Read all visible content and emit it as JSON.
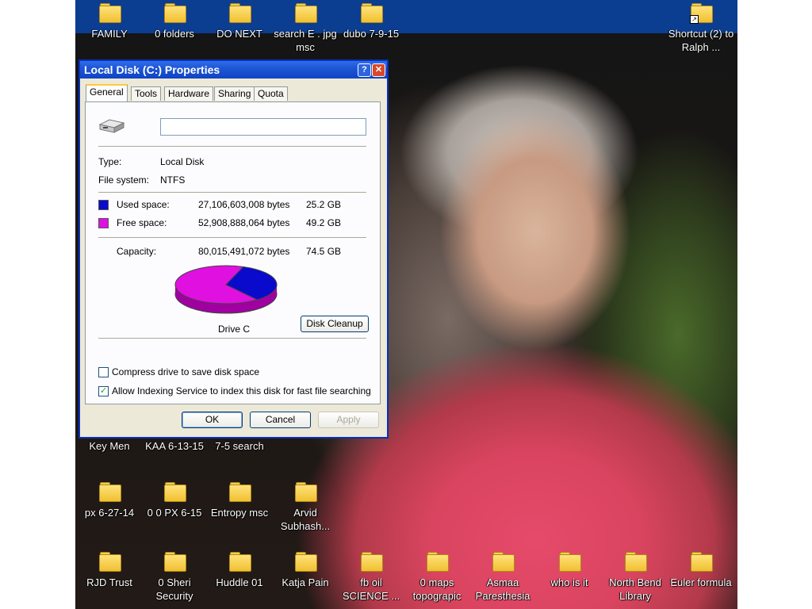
{
  "desktop": {
    "icons": [
      {
        "id": "family",
        "label": "FAMILY"
      },
      {
        "id": "0folders",
        "label": "0 folders"
      },
      {
        "id": "donext",
        "label": "DO NEXT"
      },
      {
        "id": "searche",
        "label": "search E . jpg msc"
      },
      {
        "id": "dubo",
        "label": "dubo 7-9-15"
      },
      {
        "id": "shortcut-ralph",
        "label": "Shortcut (2) to Ralph ..."
      },
      {
        "id": "keymen",
        "label": "Key Men"
      },
      {
        "id": "kaa",
        "label": "KAA 6-13-15"
      },
      {
        "id": "search75",
        "label": "7-5 search"
      },
      {
        "id": "px627",
        "label": "px 6-27-14"
      },
      {
        "id": "00px",
        "label": "0 0 PX 6-15"
      },
      {
        "id": "entropy",
        "label": "Entropy msc"
      },
      {
        "id": "arvid",
        "label": "Arvid Subhash..."
      },
      {
        "id": "rjd",
        "label": "RJD Trust"
      },
      {
        "id": "sheri",
        "label": "0 Sheri Security"
      },
      {
        "id": "huddle",
        "label": "Huddle 01"
      },
      {
        "id": "katja",
        "label": "Katja Pain"
      },
      {
        "id": "fboil",
        "label": "fb oil SCIENCE ..."
      },
      {
        "id": "maps",
        "label": "0 maps topograpic"
      },
      {
        "id": "asmaa",
        "label": "Asmaa Paresthesia"
      },
      {
        "id": "whois",
        "label": "who is it"
      },
      {
        "id": "northbend",
        "label": "North Bend Library"
      },
      {
        "id": "euler",
        "label": "Euler formula"
      }
    ]
  },
  "dialog": {
    "title": "Local Disk (C:) Properties",
    "help": "?",
    "close": "✕",
    "tabs": [
      "General",
      "Tools",
      "Hardware",
      "Sharing",
      "Quota"
    ],
    "name_value": "",
    "type_label": "Type:",
    "type_value": "Local Disk",
    "fs_label": "File system:",
    "fs_value": "NTFS",
    "used_label": "Used space:",
    "used_bytes": "27,106,603,008 bytes",
    "used_gb": "25.2 GB",
    "used_color": "#0a0acc",
    "free_label": "Free space:",
    "free_bytes": "52,908,888,064 bytes",
    "free_gb": "49.2 GB",
    "free_color": "#e010e0",
    "capacity_label": "Capacity:",
    "capacity_bytes": "80,015,491,072 bytes",
    "capacity_gb": "74.5 GB",
    "drive_label": "Drive C",
    "cleanup": "Disk Cleanup",
    "compress": "Compress drive to save disk space",
    "compress_checked": false,
    "indexing": "Allow Indexing Service to index this disk for fast file searching",
    "indexing_checked": true,
    "ok": "OK",
    "cancel": "Cancel",
    "apply": "Apply"
  }
}
